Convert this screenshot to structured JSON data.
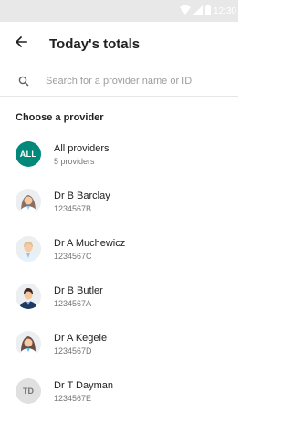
{
  "status_bar": {
    "time": "12:30",
    "icons": [
      "wifi-icon",
      "signal-icon",
      "battery-icon"
    ]
  },
  "app_bar": {
    "back_icon": "arrow-left-icon",
    "title": "Today's totals"
  },
  "search": {
    "icon": "search-icon",
    "placeholder": "Search for a provider name or ID",
    "value": ""
  },
  "section_label": "Choose a provider",
  "colors": {
    "accent": "#00897b",
    "initials_bg": "#e0e0e0"
  },
  "providers": [
    {
      "avatar_type": "text",
      "avatar_text": "ALL",
      "name": "All providers",
      "sub": "5 providers"
    },
    {
      "avatar_type": "photo",
      "avatar_icon": "female-doctor-avatar",
      "name": "Dr B Barclay",
      "sub": "1234567B"
    },
    {
      "avatar_type": "photo",
      "avatar_icon": "male-doctor-avatar",
      "name": "Dr A Muchewicz",
      "sub": "1234567C"
    },
    {
      "avatar_type": "photo",
      "avatar_icon": "male-doctor-suit-avatar",
      "name": "Dr B Butler",
      "sub": "1234567A"
    },
    {
      "avatar_type": "photo",
      "avatar_icon": "female-doctor-avatar",
      "name": "Dr A Kegele",
      "sub": "1234567D"
    },
    {
      "avatar_type": "initials",
      "avatar_text": "TD",
      "name": "Dr T Dayman",
      "sub": "1234567E"
    }
  ]
}
